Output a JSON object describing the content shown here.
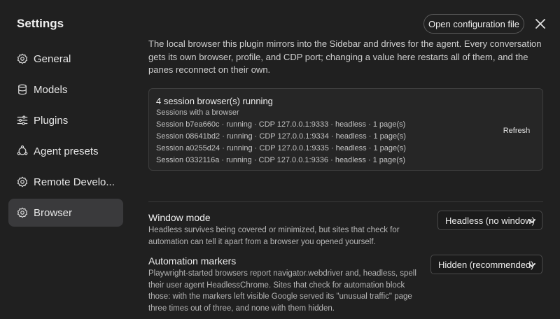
{
  "sidebar": {
    "title": "Settings",
    "items": [
      {
        "label": "General",
        "icon": "gear-icon"
      },
      {
        "label": "Models",
        "icon": "database-icon"
      },
      {
        "label": "Plugins",
        "icon": "sliders-icon"
      },
      {
        "label": "Agent presets",
        "icon": "agent-icon"
      },
      {
        "label": "Remote Develo...",
        "icon": "gear-icon"
      },
      {
        "label": "Browser",
        "icon": "gear-icon",
        "active": true
      }
    ]
  },
  "header": {
    "open_config_label": "Open configuration file"
  },
  "main": {
    "intro": "The local browser this plugin mirrors into the Sidebar and drives for the agent. Every conversation gets its own browser, profile, and CDP port; changing a value here restarts all of them, and the panes reconnect on their own.",
    "status": {
      "title": "4 session browser(s) running",
      "subtitle": "Sessions with a browser",
      "sessions": [
        "Session b7ea660c · running · CDP 127.0.0.1:9333 · headless · 1 page(s)",
        "Session 08641bd2 · running · CDP 127.0.0.1:9334 · headless · 1 page(s)",
        "Session a0255d24 · running · CDP 127.0.0.1:9335 · headless · 1 page(s)",
        "Session 0332116a · running · CDP 127.0.0.1:9336 · headless · 1 page(s)"
      ],
      "refresh_label": "Refresh"
    },
    "window_mode": {
      "title": "Window mode",
      "description": "Headless survives being covered or minimized, but sites that check for automation can tell it apart from a browser you opened yourself.",
      "selected": "Headless (no window)"
    },
    "automation_markers": {
      "title": "Automation markers",
      "description": "Playwright-started browsers report navigator.webdriver and, headless, spell their user agent HeadlessChrome. Sites that check for automation block those: with the markers left visible Google served its \"unusual traffic\" page three times out of three, and none with them hidden.",
      "selected": "Hidden (recommended)"
    }
  }
}
